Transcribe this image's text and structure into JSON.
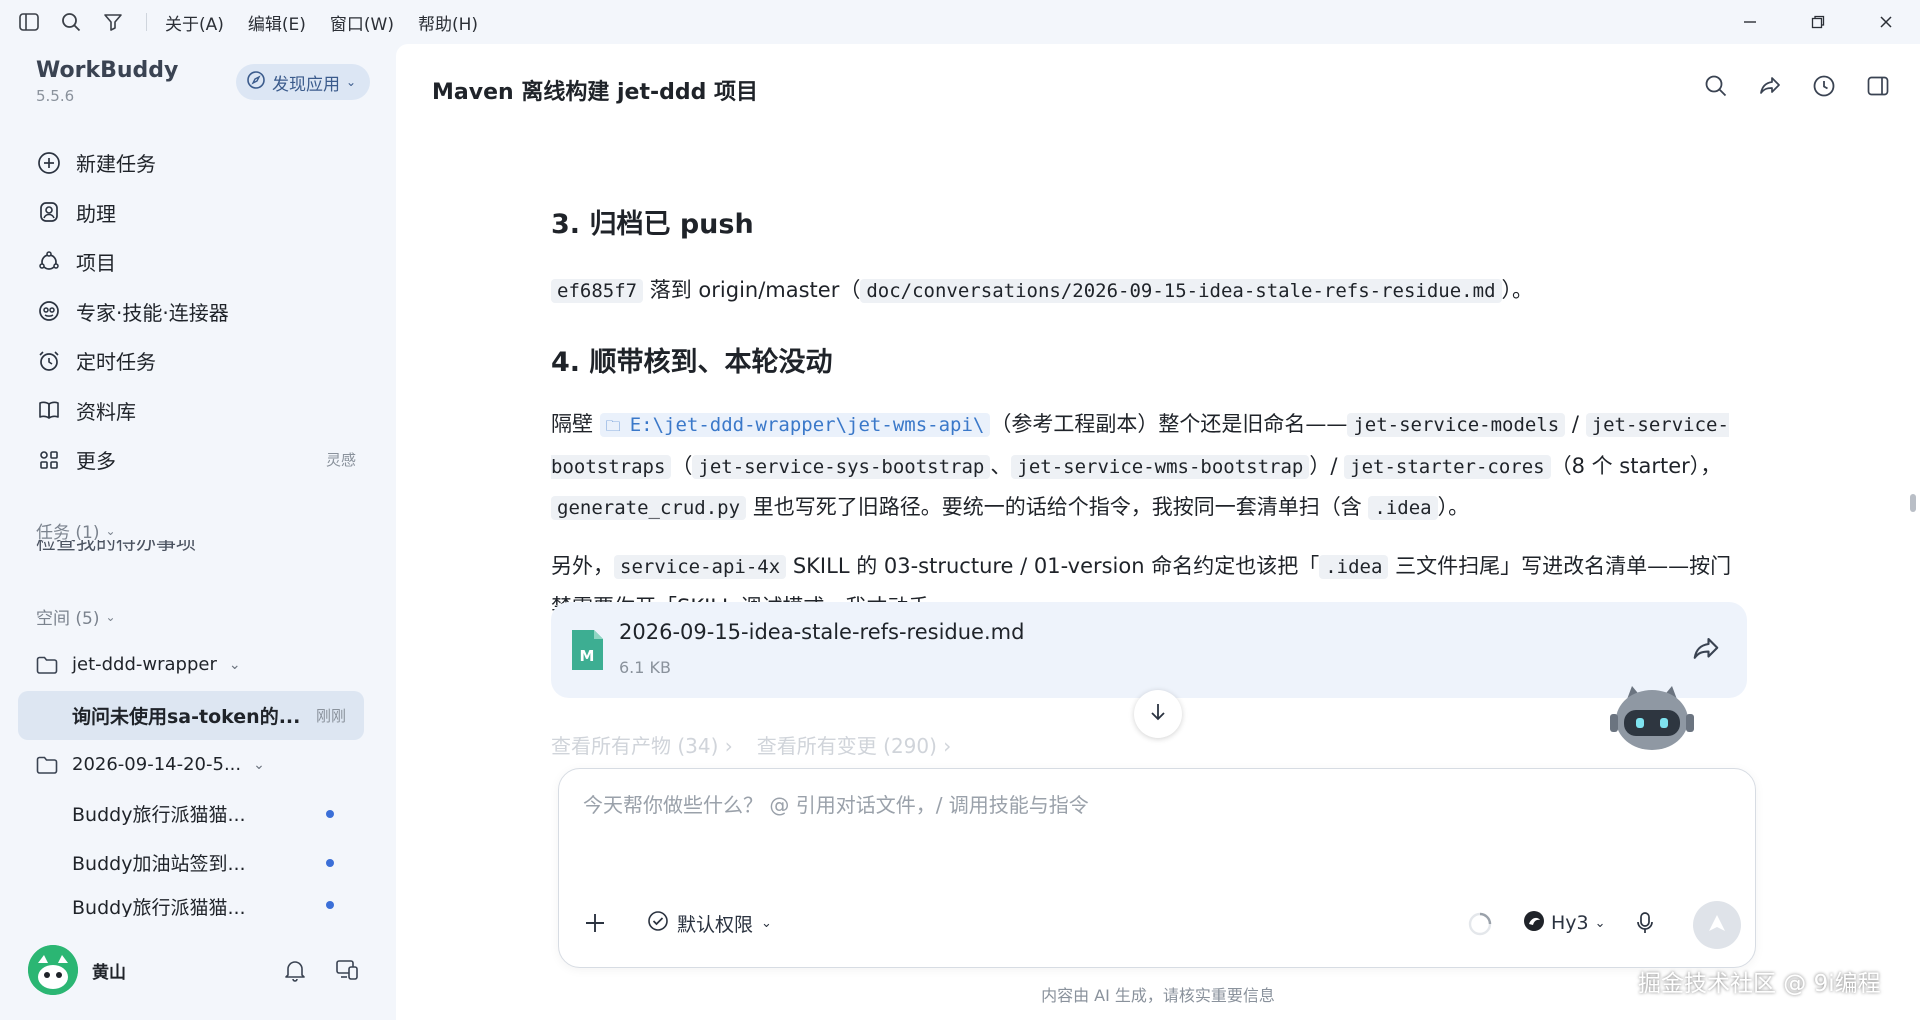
{
  "menu": [
    "关于(A)",
    "编辑(E)",
    "窗口(W)",
    "帮助(H)"
  ],
  "app": {
    "name": "WorkBuddy",
    "version": "5.5.6",
    "discover_label": "发现应用"
  },
  "nav": [
    {
      "label": "新建任务",
      "icon": "new-task-icon"
    },
    {
      "label": "助理",
      "icon": "assistant-icon"
    },
    {
      "label": "项目",
      "icon": "project-icon"
    },
    {
      "label": "专家·技能·连接器",
      "icon": "expert-icon"
    },
    {
      "label": "定时任务",
      "icon": "alarm-icon"
    },
    {
      "label": "资料库",
      "icon": "book-icon"
    },
    {
      "label": "更多",
      "icon": "apps-icon",
      "extra": "灵感"
    }
  ],
  "tasks_section": {
    "label": "任务 (1)",
    "cutoff_text": "检查我的待办事项"
  },
  "spaces_section": {
    "label": "空间 (5)"
  },
  "spaces": [
    {
      "label": "jet-ddd-wrapper",
      "children": [
        {
          "label": "询问未使用sa-token的...",
          "time": "刚刚",
          "active": true
        }
      ]
    },
    {
      "label": "2026-09-14-20-5...",
      "children": [
        {
          "label": "Buddy旅行派猫猫..."
        },
        {
          "label": "Buddy加油站签到..."
        },
        {
          "label": "Buddy旅行派猫猫..."
        }
      ]
    }
  ],
  "user": {
    "name": "黄山"
  },
  "main": {
    "title": "Maven 离线构建 jet-ddd 项目",
    "h3_1": "3. 归档已 push",
    "p1": {
      "code1": "ef685f7",
      "t1": " 落到 origin/master（",
      "code2": "doc/conversations/2026-09-15-idea-stale-refs-residue.md",
      "t2": "）。"
    },
    "h3_2": "4. 顺带核到、本轮没动",
    "p2": {
      "t0": "隔壁 ",
      "path": "E:\\jet-ddd-wrapper\\jet-wms-api\\",
      "t1": "（参考工程副本）整个还是旧命名——",
      "c1": "jet-service-models",
      "t2": " / ",
      "c2": "jet-service-bootstraps",
      "t3": "（",
      "c3": "jet-service-sys-bootstrap",
      "t4": "、",
      "c4": "jet-service-wms-bootstrap",
      "t5": "）/ ",
      "c5": "jet-starter-cores",
      "t6": "（8 个 starter），",
      "c6": "generate_crud.py",
      "t7": " 里也写死了旧路径。要统一的话给个指令，我按同一套清单扫（含 ",
      "c7": ".idea",
      "t8": "）。"
    },
    "p3": {
      "t0": "另外，",
      "c1": "service-api-4x",
      "t1": " SKILL 的 03-structure / 01-version 命名约定也该把「",
      "c2": ".idea",
      "t2": " 三文件扫尾」写进改名清单——按门禁需要你开「SKILL 调试模式」我才动手。"
    },
    "file": {
      "name": "2026-09-15-idea-stale-refs-residue.md",
      "size": "6.1 KB",
      "badge": "M"
    },
    "links": [
      "查看所有产物 (34) ›",
      "查看所有变更 (290) ›"
    ],
    "composer": {
      "placeholder": "今天帮你做些什么？ @ 引用对话文件，/ 调用技能与指令",
      "permission": "默认权限",
      "model": "Hy3"
    },
    "disclaimer": "内容由 AI 生成，请核实重要信息"
  },
  "watermark": "掘金技术社区 @ 9i编程",
  "colors": {
    "accent": "#3b6fd8",
    "sidebar_bg": "#f3f6fb",
    "active_item_bg": "#dde6f2",
    "file_card_bg": "#eef3fb",
    "path_code": "#3a78c9"
  }
}
